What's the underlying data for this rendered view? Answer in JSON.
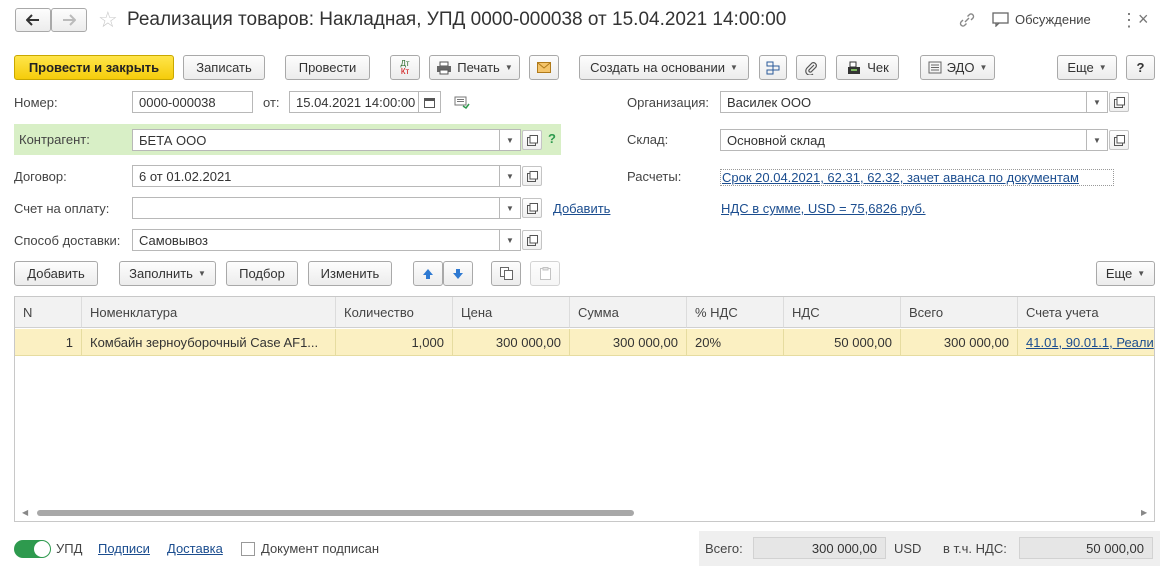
{
  "title": "Реализация товаров: Накладная, УПД 0000-000038 от 15.04.2021 14:00:00",
  "header": {
    "discuss_label": "Обсуждение"
  },
  "toolbar": {
    "post_close": "Провести и закрыть",
    "save": "Записать",
    "post": "Провести",
    "dt_kt": "Дт Кт",
    "print": "Печать",
    "create_based": "Создать на основании",
    "receipt": "Чек",
    "edo": "ЭДО",
    "more": "Еще",
    "help": "?"
  },
  "form": {
    "number_label": "Номер:",
    "number_value": "0000-000038",
    "date_label": "от:",
    "date_value": "15.04.2021 14:00:00",
    "contractor_label": "Контрагент:",
    "contractor_value": "БЕТА ООО",
    "contractor_help": "?",
    "contract_label": "Договор:",
    "contract_value": "6 от 01.02.2021",
    "invoice_label": "Счет на оплату:",
    "invoice_value": "",
    "invoice_add_link": "Добавить",
    "delivery_label": "Способ доставки:",
    "delivery_value": "Самовывоз",
    "org_label": "Организация:",
    "org_value": "Василек ООО",
    "warehouse_label": "Склад:",
    "warehouse_value": "Основной склад",
    "payments_label": "Расчеты:",
    "payments_link": "Срок 20.04.2021, 62.31, 62.32, зачет аванса по документам",
    "vat_link": "НДС в сумме, USD = 75,6826 руб."
  },
  "table_toolbar": {
    "add": "Добавить",
    "fill": "Заполнить",
    "select": "Подбор",
    "edit": "Изменить",
    "more": "Еще"
  },
  "table": {
    "columns": [
      "N",
      "Номенклатура",
      "Количество",
      "Цена",
      "Сумма",
      "% НДС",
      "НДС",
      "Всего",
      "Счета учета"
    ],
    "rows": [
      [
        "1",
        "Комбайн зерноуборочный Case AF1...",
        "1,000",
        "300 000,00",
        "300 000,00",
        "20%",
        "50 000,00",
        "300 000,00",
        "41.01, 90.01.1, Реали"
      ]
    ]
  },
  "footer": {
    "upd_label": "УПД",
    "signatures_link": "Подписи",
    "delivery_link": "Доставка",
    "signed_label": "Документ подписан",
    "total_label": "Всего:",
    "total_value": "300 000,00",
    "currency": "USD",
    "vat_label": "в т.ч. НДС:",
    "vat_value": "50 000,00"
  },
  "colors": {
    "primary_button": "#f5cc0b",
    "selected_row": "#fbf0c2",
    "highlight_field": "#d8efc6",
    "toggle_on": "#2e9a4e",
    "link": "#1b4d8f"
  }
}
